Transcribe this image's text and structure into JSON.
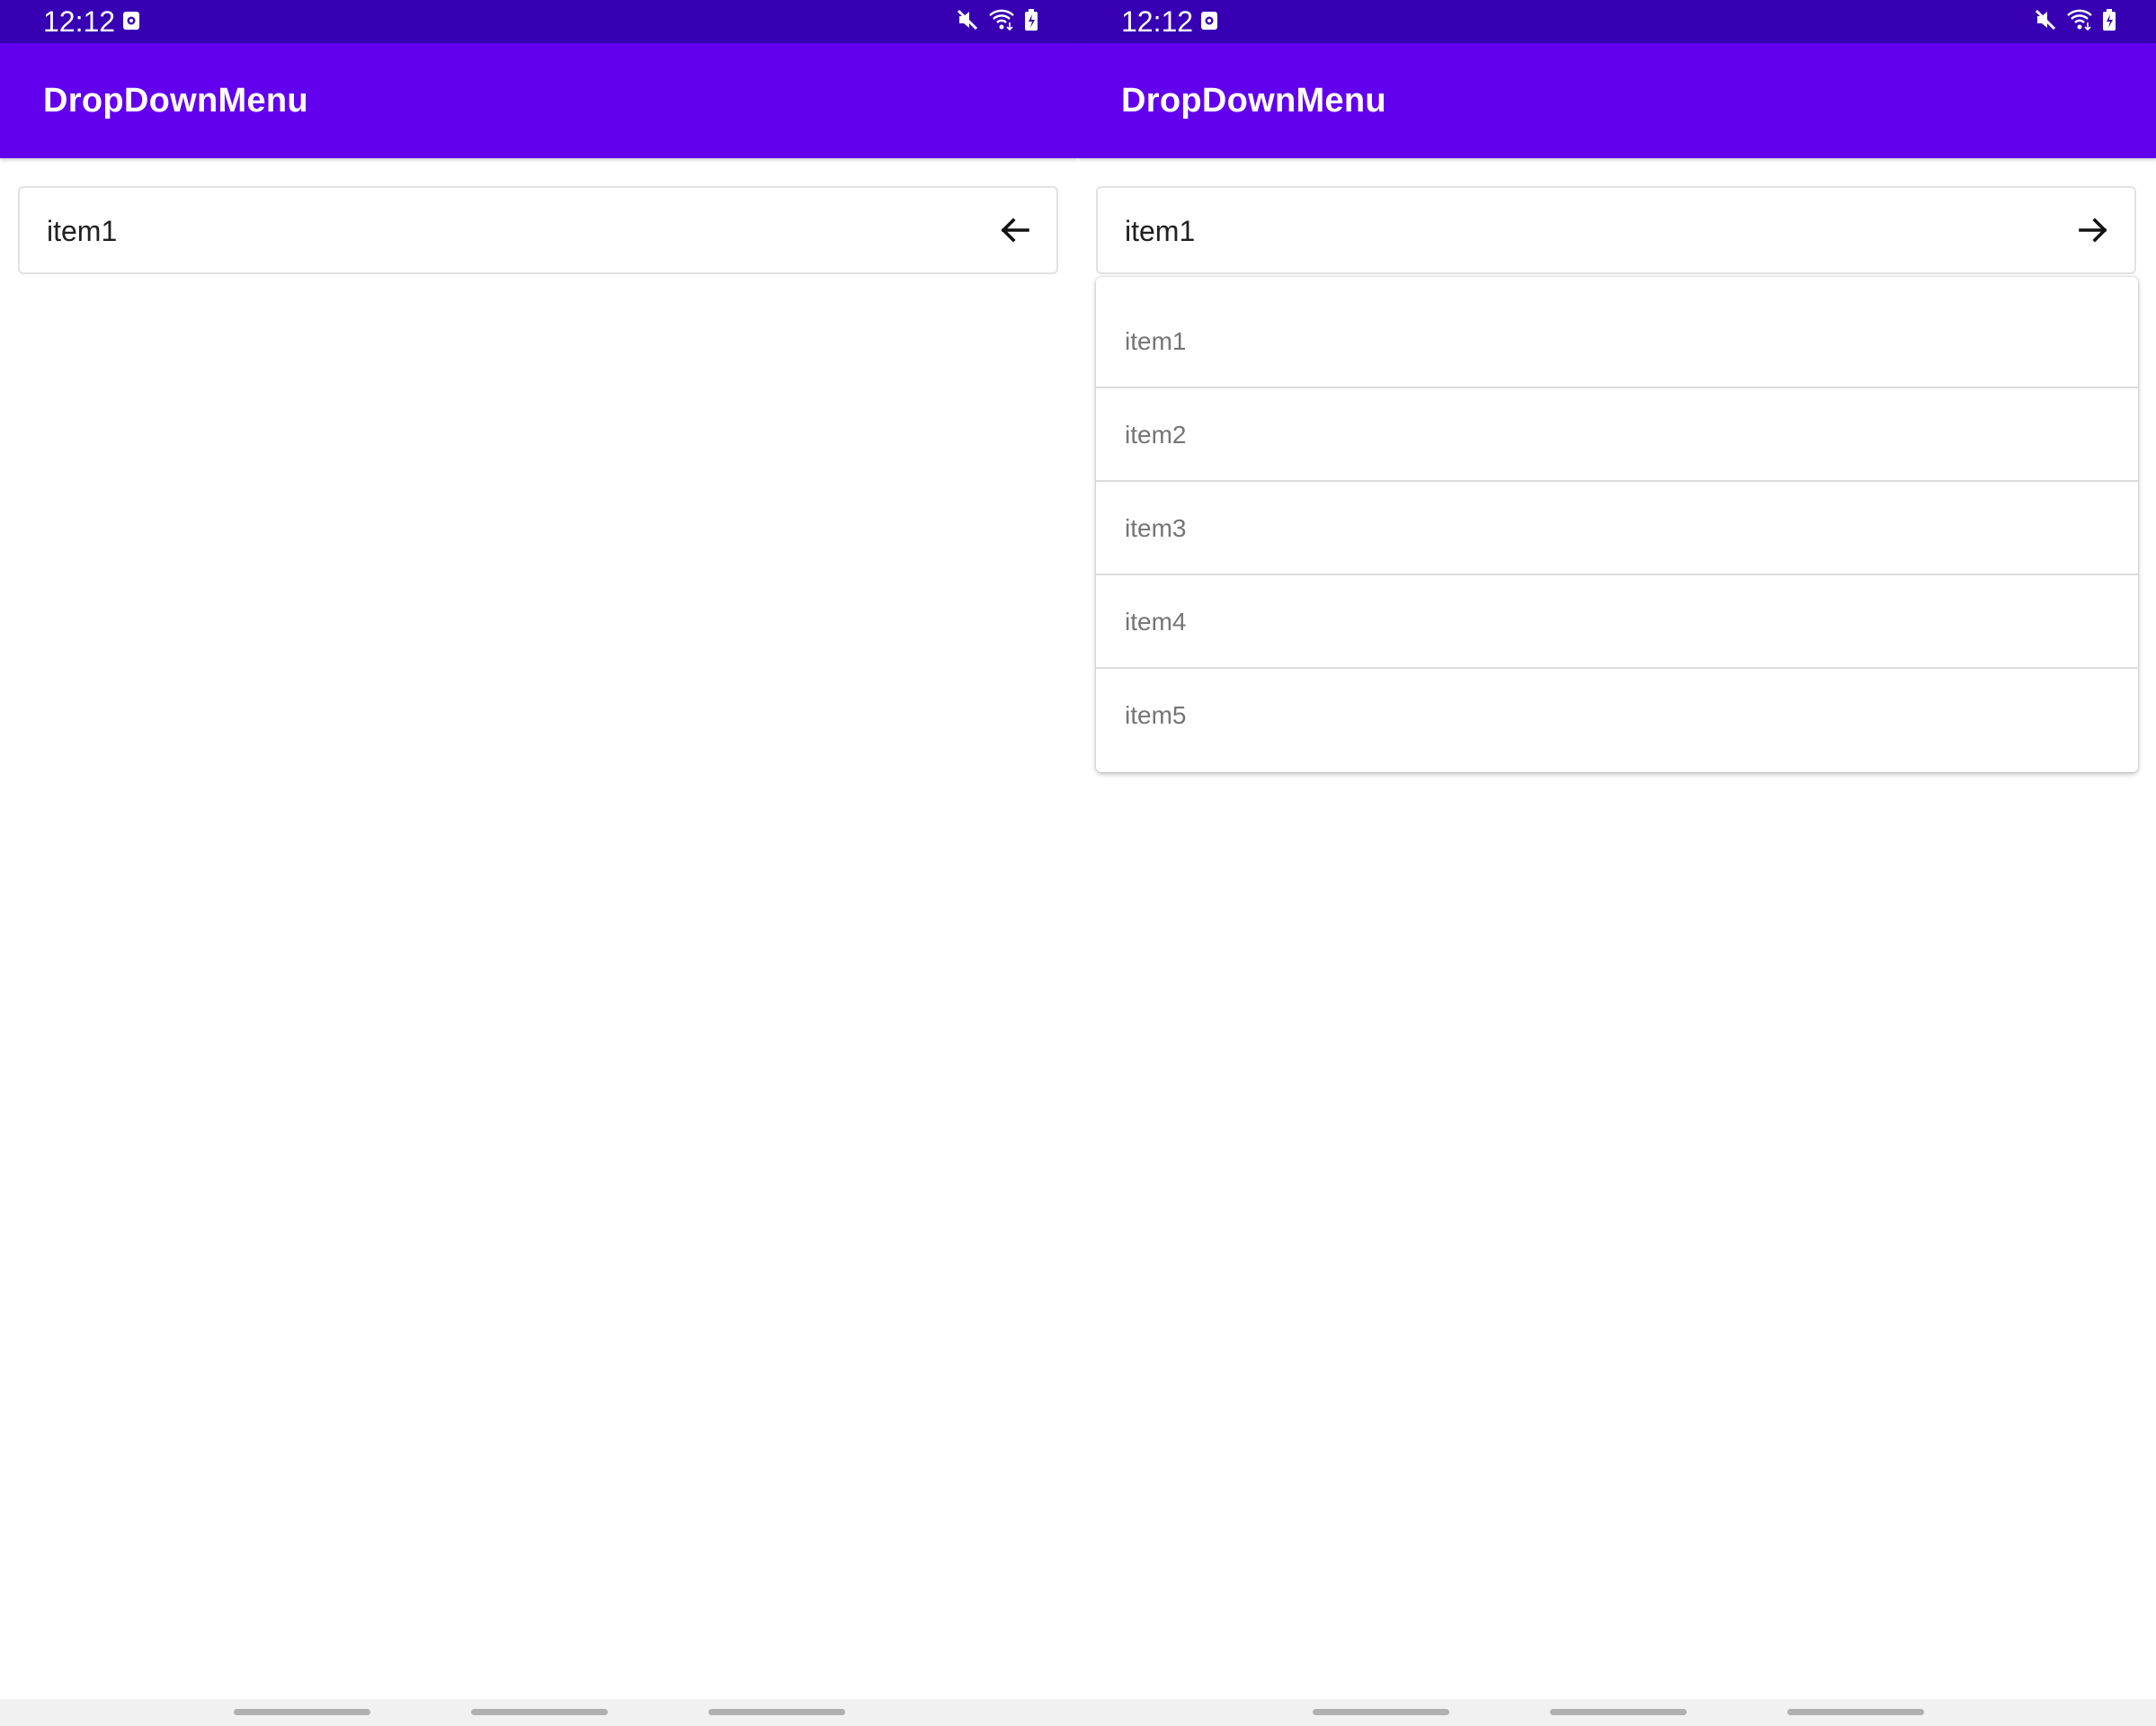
{
  "status_bar": {
    "time": "12:12",
    "icons": [
      "notification-icon",
      "mute-icon",
      "wifi-icon",
      "battery-charging-icon"
    ]
  },
  "panes": [
    {
      "app_title": "DropDownMenu",
      "dropdown": {
        "selected": "item1",
        "expanded": false,
        "arrow_icon": "arrow-left-icon"
      }
    },
    {
      "app_title": "DropDownMenu",
      "dropdown": {
        "selected": "item1",
        "expanded": true,
        "arrow_icon": "arrow-right-icon",
        "options": [
          "item1",
          "item2",
          "item3",
          "item4",
          "item5"
        ]
      }
    }
  ],
  "colors": {
    "status_bar": "#3700b3",
    "app_bar": "#6200ee",
    "menu_text": "#757575"
  }
}
